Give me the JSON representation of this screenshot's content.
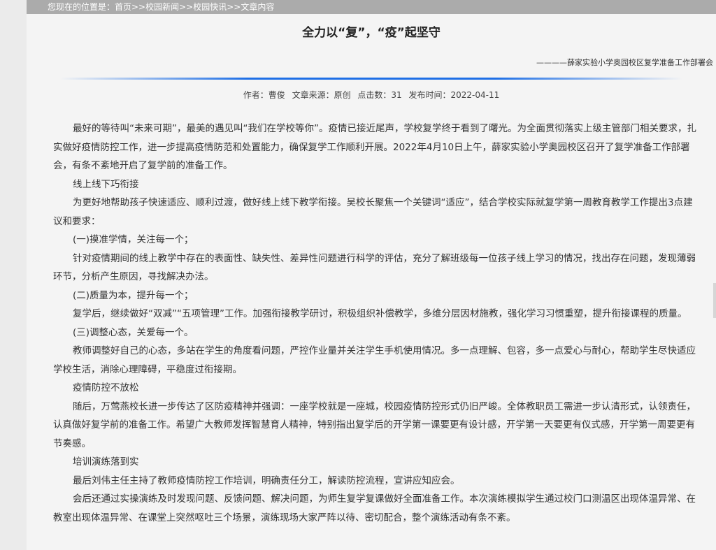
{
  "breadcrumb": "您现在的位置是：首页>>校园新闻>>校园快讯>>文章内容",
  "article": {
    "title": "全力以“复”，“疫”起坚守",
    "byline": "————薛家实验小学奥园校区复学准备工作部署会",
    "meta": {
      "author": "作者：曹俊",
      "source": "文章来源：原创",
      "clicks": "点击数：31",
      "date": "发布时间：2022-04-11"
    },
    "paragraphs": [
      "最好的等待叫“未来可期”，最美的遇见叫“我们在学校等你”。疫情已接近尾声，学校复学终于看到了曙光。为全面贯彻落实上级主管部门相关要求，扎实做好疫情防控工作，进一步提高疫情防范和处置能力，确保复学工作顺利开展。2022年4月10日上午，薛家实验小学奥园校区召开了复学准备工作部署会，有条不紊地开启了复学前的准备工作。",
      "线上线下巧衔接",
      "为更好地帮助孩子快速适应、顺利过渡，做好线上线下教学衔接。吴校长聚焦一个关键词“适应”，结合学校实际就复学第一周教育教学工作提出3点建议和要求：",
      "(一)摸准学情，关注每一个；",
      "针对疫情期间的线上教学中存在的表面性、缺失性、差异性问题进行科学的评估，充分了解班级每一位孩子线上学习的情况，找出存在问题，发现薄弱环节，分析产生原因，寻找解决办法。",
      "(二)质量为本，提升每一个；",
      "复学后，继续做好“双减”“五项管理”工作。加强衔接教学研讨，积极组织补偿教学，多维分层因材施教，强化学习习惯重塑，提升衔接课程的质量。",
      "(三)调整心态，关爱每一个。",
      "教师调整好自己的心态，多站在学生的角度看问题，严控作业量并关注学生手机使用情况。多一点理解、包容，多一点爱心与耐心，帮助学生尽快适应学校生活，消除心理障碍，平稳度过衔接期。",
      "疫情防控不放松",
      "随后，万莺燕校长进一步传达了区防疫精神并强调：一座学校就是一座城，校园疫情防控形式仍旧严峻。全体教职员工需进一步认清形式，认领责任，认真做好复学前的准备工作。希望广大教师发挥智慧育人精神，特别指出复学后的开学第一课要更有设计感，开学第一天要更有仪式感，开学第一周要更有节奏感。",
      "培训演练落到实",
      "最后刘伟主任主持了教师疫情防控工作培训，明确责任分工，解读防控流程，宣讲应知应会。",
      "会后还通过实操演练及时发现问题、反馈问题、解决问题，为师生复学复课做好全面准备工作。本次演练模拟学生通过校门口测温区出现体温异常、在教室出现体温异常、在课堂上突然呕吐三个场景，演练现场大家严阵以待、密切配合，整个演练活动有条不紊。"
    ]
  }
}
